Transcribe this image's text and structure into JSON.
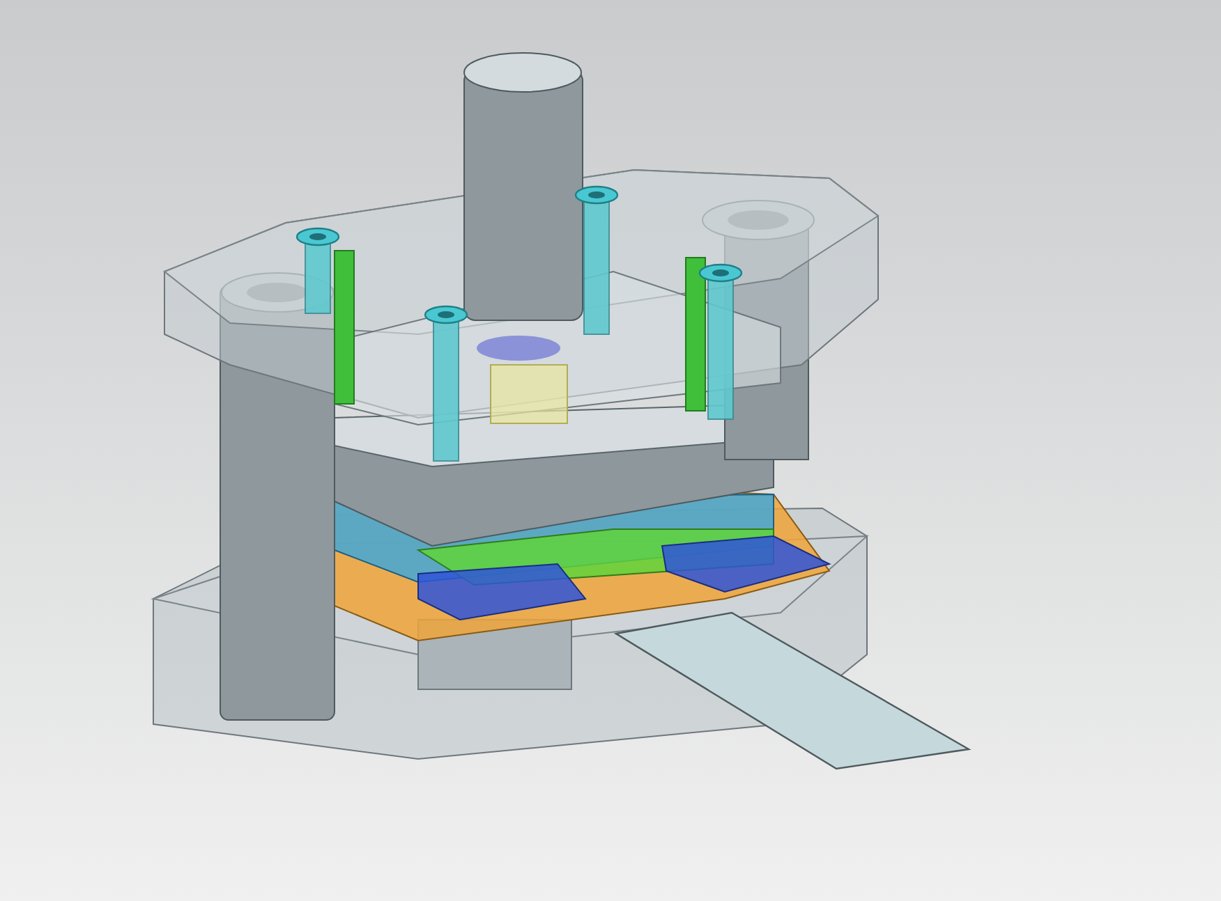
{
  "viewport": {
    "kind": "die-set"
  }
}
